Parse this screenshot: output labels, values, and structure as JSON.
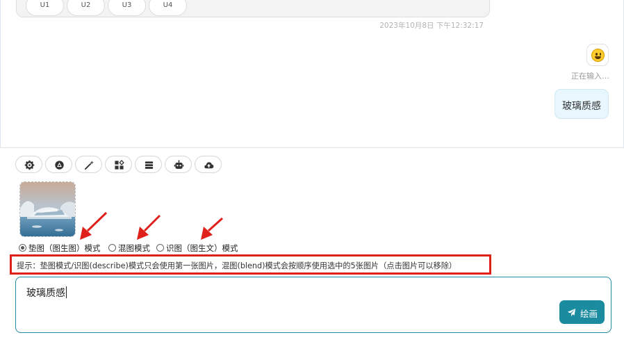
{
  "chat": {
    "bot_message": {
      "buttons": [
        "U1",
        "U2",
        "U3",
        "U4"
      ],
      "timestamp": "2023年10月8日 下午12:32:17"
    },
    "user_message": {
      "avatar_icon": "smiley-face-icon",
      "status": "正在输入…",
      "text": "玻璃质感"
    }
  },
  "toolbar": {
    "items": [
      {
        "icon": "gear-icon"
      },
      {
        "icon": "openai-logo-icon"
      },
      {
        "icon": "magic-wand-icon"
      },
      {
        "icon": "apps-grid-icon"
      },
      {
        "icon": "layers-icon"
      },
      {
        "icon": "robot-icon"
      },
      {
        "icon": "cloud-upload-icon"
      }
    ]
  },
  "attachments": [
    {
      "alt": "uploaded image thumbnail"
    }
  ],
  "modes": {
    "options": [
      {
        "label": "垫图（图生图）模式",
        "selected": true
      },
      {
        "label": "混图模式",
        "selected": false
      },
      {
        "label": "识图（图生文）模式",
        "selected": false
      }
    ]
  },
  "hint": {
    "text": "提示：垫图模式/识图(describe)模式只会使用第一张图片，混图(blend)模式会按顺序使用选中的5张图片（点击图片可以移除）"
  },
  "input": {
    "value": "玻璃质感"
  },
  "submit": {
    "label": "绘画",
    "icon": "send-icon"
  },
  "colors": {
    "accent": "#1b8ba0",
    "annotation": "#e0201a",
    "user_bubble": "#e8f7fd"
  }
}
